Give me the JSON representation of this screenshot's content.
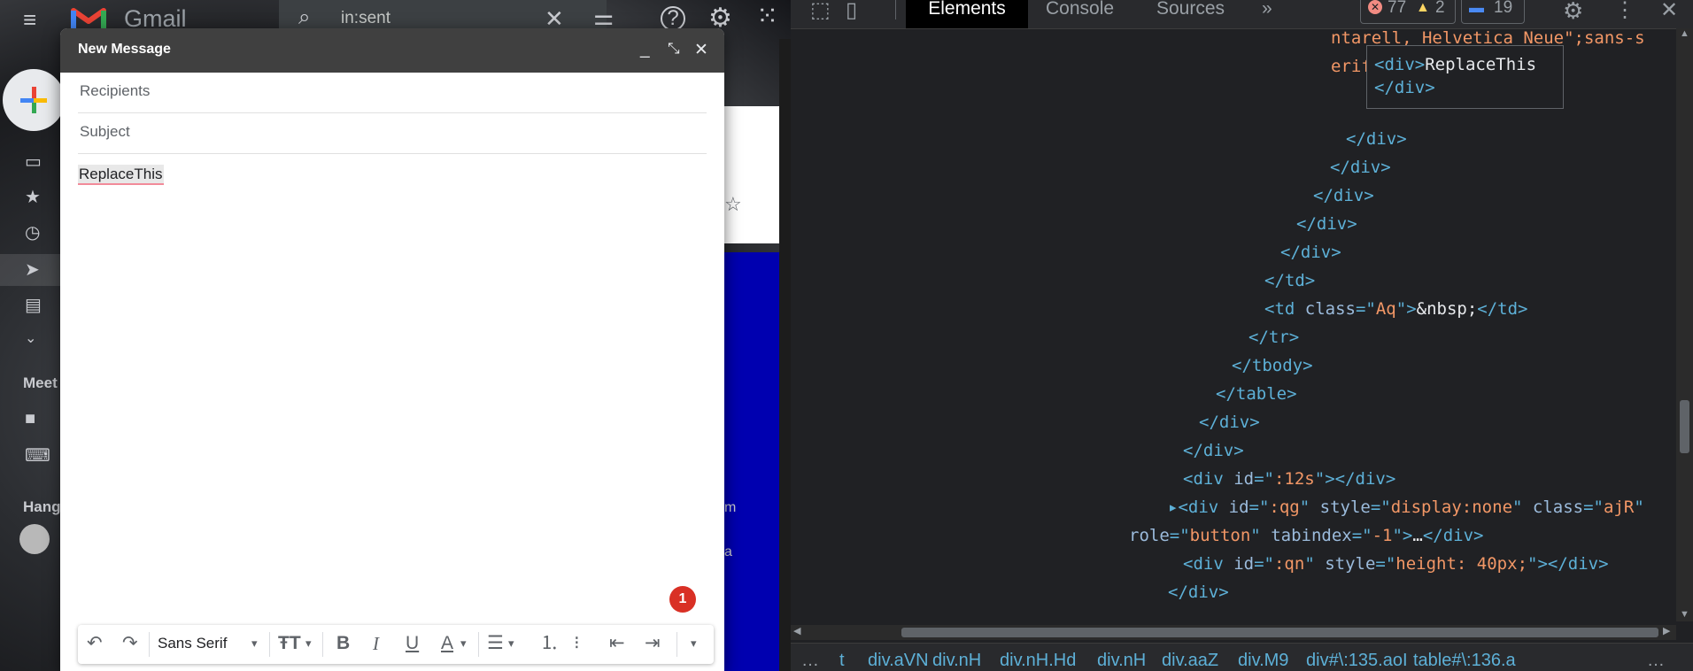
{
  "gmail": {
    "app_name": "Gmail",
    "search": {
      "value": "in:sent"
    },
    "sidebar": {
      "meet_label": "Meet",
      "hangouts_label": "Hang"
    },
    "side_fragments": [
      "m",
      "a"
    ],
    "icons": [
      "menu-icon",
      "gmail-logo-icon",
      "search-icon",
      "clear-search-icon",
      "search-options-icon",
      "help-icon",
      "settings-icon",
      "apps-icon",
      "compose-plus-icon",
      "inbox-icon",
      "starred-icon",
      "snoozed-icon",
      "sent-icon",
      "drafts-icon",
      "more-icon",
      "video-icon",
      "keyboard-icon",
      "avatar"
    ]
  },
  "compose": {
    "title": "New Message",
    "recipients_placeholder": "Recipients",
    "subject_placeholder": "Subject",
    "body_text": "ReplaceThis",
    "badge_count": "1",
    "font_family": "Sans Serif",
    "toolbar_icons": [
      "undo-icon",
      "redo-icon",
      "font-dropdown-icon",
      "text-size-icon",
      "bold-icon",
      "italic-icon",
      "underline-icon",
      "text-color-icon",
      "align-icon",
      "numbered-list-icon",
      "bulleted-list-icon",
      "indent-less-icon",
      "indent-more-icon",
      "more-formatting-icon"
    ]
  },
  "devtools": {
    "tabs": [
      "Elements",
      "Console",
      "Sources",
      "»"
    ],
    "errors": "77",
    "warnings": "2",
    "messages": "19",
    "tooltip_lines": [
      "ReplaceThis",
      "</div>"
    ],
    "code_lines": [
      {
        "parts": [
          [
            "val",
            "ntarell, Helvetica Neue\";sans-s"
          ]
        ]
      },
      {
        "parts": [
          [
            "val",
            "erif;font-size:14px"
          ],
          [
            "tag",
            "\">"
          ]
        ]
      },
      {
        "parts": [
          [
            "tag",
            "</div>"
          ]
        ]
      },
      {
        "parts": [
          [
            "tag",
            "</div>"
          ]
        ]
      },
      {
        "parts": [
          [
            "tag",
            "</div>"
          ]
        ]
      },
      {
        "parts": [
          [
            "tag",
            "</div>"
          ]
        ]
      },
      {
        "parts": [
          [
            "tag",
            "</div>"
          ]
        ]
      },
      {
        "parts": [
          [
            "tag",
            "</td>"
          ]
        ]
      },
      {
        "parts": [
          [
            "tag",
            "<td "
          ],
          [
            "attr",
            "class"
          ],
          [
            "tag",
            "=\""
          ],
          [
            "val",
            "Aq"
          ],
          [
            "tag",
            "\">"
          ],
          [
            "txt",
            "&nbsp;"
          ],
          [
            "tag",
            "</td>"
          ]
        ]
      },
      {
        "parts": [
          [
            "tag",
            "</tr>"
          ]
        ]
      },
      {
        "parts": [
          [
            "tag",
            "</tbody>"
          ]
        ]
      },
      {
        "parts": [
          [
            "tag",
            "</table>"
          ]
        ]
      },
      {
        "parts": [
          [
            "tag",
            "</div>"
          ]
        ]
      },
      {
        "parts": [
          [
            "tag",
            "</div>"
          ]
        ]
      },
      {
        "parts": [
          [
            "tag",
            "<div "
          ],
          [
            "attr",
            "id"
          ],
          [
            "tag",
            "=\""
          ],
          [
            "val",
            ":12s"
          ],
          [
            "tag",
            "\"></div>"
          ]
        ]
      },
      {
        "parts": [
          [
            "tag",
            "▸<div "
          ],
          [
            "attr",
            "id"
          ],
          [
            "tag",
            "=\""
          ],
          [
            "val",
            ":qg"
          ],
          [
            "tag",
            "\" "
          ],
          [
            "attr",
            "style"
          ],
          [
            "tag",
            "=\""
          ],
          [
            "val",
            "display:none"
          ],
          [
            "tag",
            "\" "
          ],
          [
            "attr",
            "class"
          ],
          [
            "tag",
            "=\""
          ],
          [
            "val",
            "ajR"
          ],
          [
            "tag",
            "\""
          ]
        ]
      },
      {
        "parts": [
          [
            "attr",
            "role"
          ],
          [
            "tag",
            "=\""
          ],
          [
            "val",
            "button"
          ],
          [
            "tag",
            "\" "
          ],
          [
            "attr",
            "tabindex"
          ],
          [
            "tag",
            "=\""
          ],
          [
            "val",
            "-1"
          ],
          [
            "tag",
            "\">"
          ],
          [
            "txt",
            "…"
          ],
          [
            "tag",
            "</div>"
          ]
        ]
      },
      {
        "parts": [
          [
            "tag",
            "<div "
          ],
          [
            "attr",
            "id"
          ],
          [
            "tag",
            "=\""
          ],
          [
            "val",
            ":qn"
          ],
          [
            "tag",
            "\" "
          ],
          [
            "attr",
            "style"
          ],
          [
            "tag",
            "=\""
          ],
          [
            "val",
            "height: 40px;"
          ],
          [
            "tag",
            "\"></div>"
          ]
        ]
      },
      {
        "parts": [
          [
            "tag",
            "</div>"
          ]
        ]
      }
    ],
    "breadcrumbs": [
      "…",
      "t",
      "div.aVN",
      "div.nH",
      "div.nH.Hd",
      "div.nH",
      "div.aaZ",
      "div.M9",
      "div#\\:135.aoI",
      "table#\\:136.a",
      "…"
    ]
  }
}
